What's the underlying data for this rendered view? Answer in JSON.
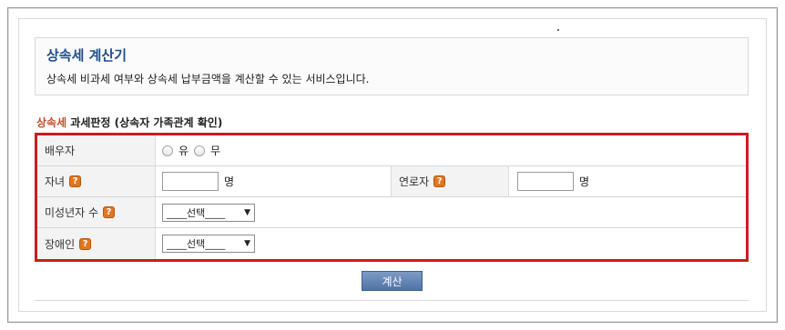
{
  "header": {
    "title": "상속세 계산기",
    "description": "상속세 비과세 여부와 상속세 납부금액을 계산할 수 있는 서비스입니다."
  },
  "section": {
    "title_accent": "상속세",
    "title_rest": " 과세판정 (상속자 가족관계 확인)"
  },
  "form": {
    "spouse": {
      "label": "배우자",
      "options": [
        "유",
        "무"
      ],
      "selected": null
    },
    "children": {
      "label": "자녀",
      "value": "",
      "unit": "명"
    },
    "elderly": {
      "label": "연로자",
      "value": "",
      "unit": "명"
    },
    "minors": {
      "label": "미성년자 수",
      "selected": "____선택____"
    },
    "disabled": {
      "label": "장애인",
      "selected": "____선택____"
    }
  },
  "icons": {
    "help": "?",
    "dropdown_arrow": "▼"
  },
  "button": {
    "calculate_label": "계산"
  },
  "colors": {
    "title_blue": "#1f4e8c",
    "accent_orange": "#c0502b",
    "highlight_red": "#cc1a22",
    "button_blue": "#4f73a6",
    "help_icon_orange": "#e0761e"
  }
}
